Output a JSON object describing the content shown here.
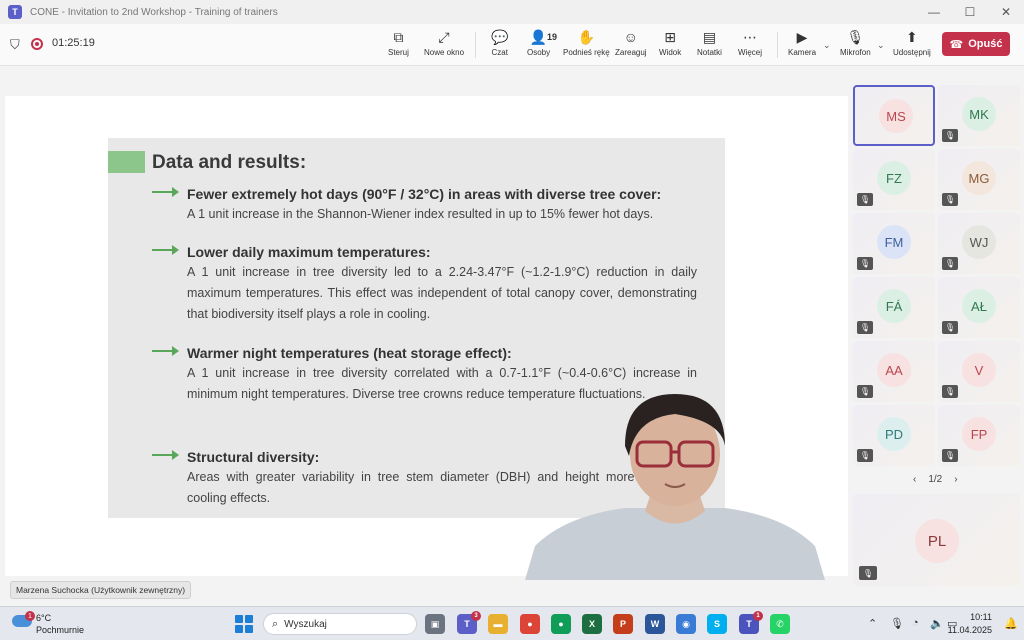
{
  "window": {
    "title": "CONE - Invitation to 2nd Workshop - Training of trainers",
    "app_icon": "T",
    "controls": [
      "—",
      "☐",
      "✕"
    ]
  },
  "toolbar": {
    "timer": "01:25:19",
    "buttons": [
      {
        "label": "Steruj",
        "icon": "control-icon"
      },
      {
        "label": "Nowe okno",
        "icon": "new-window-icon"
      },
      {
        "label": "Czat",
        "icon": "chat-icon"
      },
      {
        "label": "Osoby",
        "icon": "people-icon",
        "badge": "19"
      },
      {
        "label": "Podnieś rękę",
        "icon": "raise-hand-icon"
      },
      {
        "label": "Zareaguj",
        "icon": "react-icon"
      },
      {
        "label": "Widok",
        "icon": "view-icon"
      },
      {
        "label": "Notatki",
        "icon": "notes-icon"
      },
      {
        "label": "Więcej",
        "icon": "more-icon"
      },
      {
        "label": "Kamera",
        "icon": "camera-off-icon"
      },
      {
        "label": "Mikrofon",
        "icon": "mic-off-icon"
      },
      {
        "label": "Udostępnij",
        "icon": "share-icon"
      }
    ],
    "leave_label": "Opuść"
  },
  "slide": {
    "title": "Data and results:",
    "points": [
      {
        "heading": "Fewer extremely hot days (90°F / 32°C) in areas with diverse tree cover:",
        "body": "A 1 unit increase in the Shannon-Wiener index resulted in up to 15% fewer hot days."
      },
      {
        "heading": "Lower daily maximum temperatures:",
        "body": "A 1 unit increase in tree diversity led to a 2.24-3.47°F (~1.2-1.9°C) reduction in daily maximum temperatures. This effect was independent of total canopy cover, demonstrating that biodiversity itself plays a role in cooling."
      },
      {
        "heading": "Warmer night temperatures (heat storage effect):",
        "body": "A 1 unit increase in tree diversity correlated with a 0.7-1.1°F (~0.4-0.6°C) increase in minimum night temperatures. Diverse tree crowns reduce temperature fluctuations."
      },
      {
        "heading": "Structural diversity:",
        "body": "Areas with greater variability in tree stem diameter (DBH) and height more significant cooling effects."
      }
    ]
  },
  "presenter": {
    "name": "Marzena Suchocka (Użytkownik zewnętrzny)"
  },
  "participants": {
    "tiles": [
      {
        "initials": "MS",
        "bg": "#f7e1e1",
        "color": "#b8474f",
        "active": true,
        "muted": false
      },
      {
        "initials": "MK",
        "bg": "#dcefe4",
        "color": "#2f7a4f",
        "active": false,
        "muted": true
      },
      {
        "initials": "FZ",
        "bg": "#dcefe4",
        "color": "#2f7a4f",
        "active": false,
        "muted": true
      },
      {
        "initials": "MG",
        "bg": "#f3e6dc",
        "color": "#8a5a3a",
        "active": false,
        "muted": true
      },
      {
        "initials": "FM",
        "bg": "#dbe4f6",
        "color": "#3f5e9e",
        "active": false,
        "muted": true
      },
      {
        "initials": "WJ",
        "bg": "#e6e6e0",
        "color": "#555555",
        "active": false,
        "muted": true
      },
      {
        "initials": "FÁ",
        "bg": "#dcefe4",
        "color": "#2f7a4f",
        "active": false,
        "muted": true
      },
      {
        "initials": "AŁ",
        "bg": "#dcefe4",
        "color": "#2f7a4f",
        "active": false,
        "muted": true
      },
      {
        "initials": "AA",
        "bg": "#f7e1e1",
        "color": "#b8474f",
        "active": false,
        "muted": true
      },
      {
        "initials": "V",
        "bg": "#f7e1e1",
        "color": "#b8474f",
        "active": false,
        "muted": true
      },
      {
        "initials": "PD",
        "bg": "#dcefee",
        "color": "#2f7a7a",
        "active": false,
        "muted": true
      },
      {
        "initials": "FP",
        "bg": "#f7e1e1",
        "color": "#b8474f",
        "active": false,
        "muted": true
      }
    ],
    "page": "1/2",
    "big": {
      "initials": "PL",
      "bg": "#f7e1e1",
      "color": "#8a3a3a",
      "muted": true
    }
  },
  "taskbar": {
    "weather_temp": "6°C",
    "weather_cond": "Pochmurnie",
    "weather_badge": "1",
    "search_placeholder": "Wyszukaj",
    "apps": [
      {
        "name": "task-view-icon",
        "color": "#6b7280",
        "glyph": "▣"
      },
      {
        "name": "teams-app-icon",
        "color": "#5b5fc7",
        "glyph": "T",
        "badge": "3"
      },
      {
        "name": "file-explorer-icon",
        "color": "#e8b030",
        "glyph": "▬"
      },
      {
        "name": "chrome-app-icon",
        "color": "#db4437",
        "glyph": "●"
      },
      {
        "name": "chrome-app-icon",
        "color": "#0f9d58",
        "glyph": "●"
      },
      {
        "name": "excel-app-icon",
        "color": "#1d6f42",
        "glyph": "X"
      },
      {
        "name": "powerpoint-app-icon",
        "color": "#c43e1c",
        "glyph": "P"
      },
      {
        "name": "word-app-icon",
        "color": "#2b579a",
        "glyph": "W"
      },
      {
        "name": "globe-app-icon",
        "color": "#3a7bd5",
        "glyph": "◉"
      },
      {
        "name": "skype-app-icon",
        "color": "#00aff0",
        "glyph": "S"
      },
      {
        "name": "teams-app-icon",
        "color": "#4b53bc",
        "glyph": "T",
        "badge": "1"
      },
      {
        "name": "whatsapp-app-icon",
        "color": "#25d366",
        "glyph": "✆"
      }
    ],
    "time": "10:11",
    "date": "11.04.2025"
  }
}
